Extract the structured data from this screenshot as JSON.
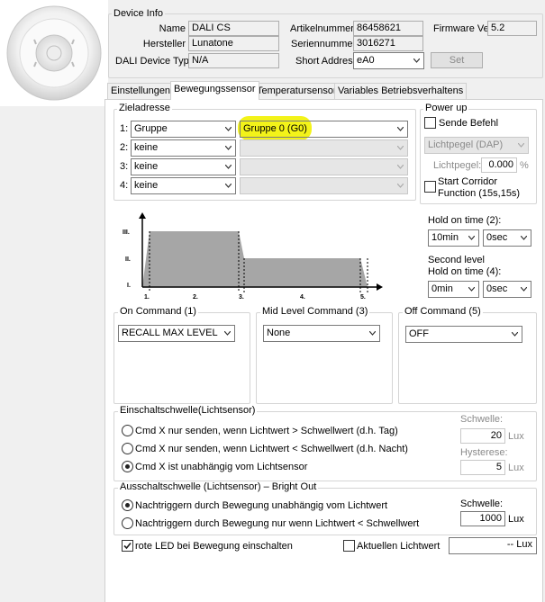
{
  "device_info": {
    "title": "Device Info",
    "name_label": "Name",
    "name_value": "DALI CS",
    "hersteller_label": "Hersteller",
    "hersteller_value": "Lunatone",
    "type_label": "DALI Device Type",
    "type_value": "N/A",
    "artikel_label": "Artikelnummer",
    "artikel_value": "86458621",
    "serien_label": "Seriennummer",
    "serien_value": "3016271",
    "short_label": "Short Address",
    "short_value": "eA0",
    "firmware_label": "Firmware Ver",
    "firmware_value": "5.2",
    "set_button": "Set"
  },
  "tabs": [
    {
      "label": "Einstellungen",
      "active": false
    },
    {
      "label": "Bewegungssensor",
      "active": true
    },
    {
      "label": "Temperatursensor",
      "active": false
    },
    {
      "label": "Variables Betriebsverhaltens",
      "active": false
    }
  ],
  "zieladresse": {
    "title": "Zieladresse",
    "rows": [
      {
        "num": "1:",
        "type": "Gruppe",
        "target": "Gruppe 0 (G0)",
        "target_enabled": true
      },
      {
        "num": "2:",
        "type": "keine",
        "target": "",
        "target_enabled": false
      },
      {
        "num": "3:",
        "type": "keine",
        "target": "",
        "target_enabled": false
      },
      {
        "num": "4:",
        "type": "keine",
        "target": "",
        "target_enabled": false
      }
    ]
  },
  "power_up": {
    "title": "Power up",
    "sende_befehl": "Sende Befehl",
    "lichtpegel_select": "Lichtpegel  (DAP)",
    "lichtpegel_label": "Lichtpegel:",
    "lichtpegel_value": "0.000",
    "percent": "%",
    "corridor_line1": "Start Corridor",
    "corridor_line2": "Function (15s,15s)"
  },
  "diagram": {
    "levels": [
      "III.",
      "II.",
      "I."
    ],
    "phases": [
      "1.",
      "2.",
      "3.",
      "4.",
      "5."
    ]
  },
  "hold": {
    "hold_label": "Hold on time (2):",
    "hold_min": "10min",
    "hold_sec": "0sec",
    "second_label1": "Second level",
    "second_label2": "Hold on time (4):",
    "second_min": "0min",
    "second_sec": "0sec"
  },
  "commands": {
    "on_title": "On Command (1)",
    "on_value": "RECALL MAX LEVEL",
    "mid_title": "Mid Level Command (3)",
    "mid_value": "None",
    "off_title": "Off Command (5)",
    "off_value": "OFF"
  },
  "einschalt": {
    "title": "Einschaltschwelle(Lichtsensor)",
    "opt1": "Cmd X nur senden, wenn Lichtwert > Schwellwert (d.h. Tag)",
    "opt2": "Cmd X nur senden, wenn Lichtwert < Schwellwert (d.h. Nacht)",
    "opt3": "Cmd X ist unabhängig vom Lichtsensor",
    "selected": 3,
    "schwelle_label": "Schwelle:",
    "schwelle_value": "20",
    "unit": "Lux",
    "hysterese_label": "Hysterese:",
    "hysterese_value": "5"
  },
  "ausschalt": {
    "title": "Ausschaltschwelle (Lichtsensor) – Bright Out",
    "opt1": "Nachtriggern durch Bewegung unabhängig vom Lichtwert",
    "opt2": "Nachtriggern durch Bewegung nur wenn Lichtwert < Schwellwert",
    "selected": 1,
    "schwelle_label": "Schwelle:",
    "schwelle_value": "1000",
    "unit": "Lux"
  },
  "bottom": {
    "led_label": "rote LED bei Bewegung einschalten",
    "led_checked": true,
    "aktuell_label": "Aktuellen Lichtwert",
    "aktuell_checked": false,
    "lux_value": "-- Lux"
  },
  "colors": {
    "highlight": "#f2f200",
    "diagram_fill": "#a6a6a6"
  }
}
